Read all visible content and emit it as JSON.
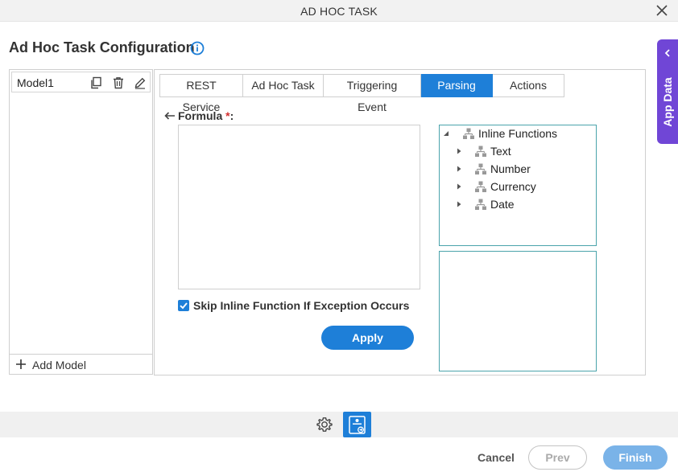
{
  "window": {
    "title": "AD HOC TASK"
  },
  "header": {
    "title": "Ad Hoc Task Configuration"
  },
  "app_data_panel": {
    "label": "App Data"
  },
  "models": {
    "items": [
      {
        "name": "Model1"
      }
    ],
    "add_label": "Add Model"
  },
  "tabs": [
    {
      "label": "REST Service"
    },
    {
      "label": "Ad Hoc Task"
    },
    {
      "label": "Triggering Event"
    },
    {
      "label": "Parsing",
      "active": true
    },
    {
      "label": "Actions"
    }
  ],
  "formula": {
    "label": "Formula",
    "required_marker": "*",
    "suffix": ":",
    "value": ""
  },
  "skip_option": {
    "label": "Skip Inline Function If Exception Occurs",
    "checked": true
  },
  "apply_label": "Apply",
  "tree": {
    "root": "Inline Functions",
    "children": [
      "Text",
      "Number",
      "Currency",
      "Date"
    ]
  },
  "footer": {
    "cancel_label": "Cancel",
    "prev_label": "Prev",
    "finish_label": "Finish"
  },
  "colors": {
    "accent": "#1e7fd8",
    "app_data_tab": "#7046d6",
    "tree_border": "#4aa3ab",
    "required": "#d32f2f"
  }
}
